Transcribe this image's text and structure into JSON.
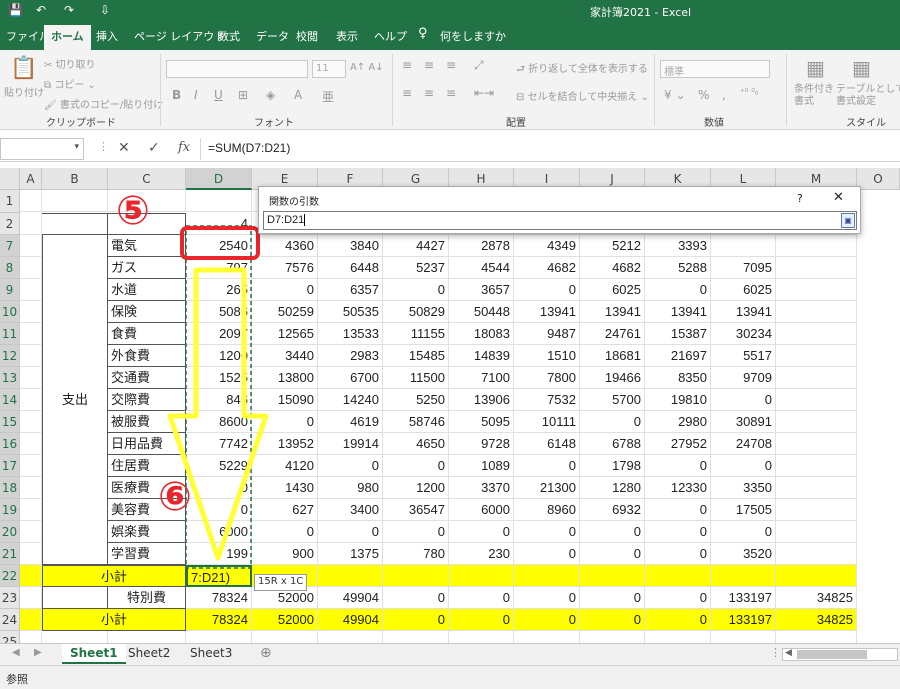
{
  "window": {
    "title": "家計簿2021 - Excel",
    "qat": [
      "💾",
      "↶",
      "↷",
      "⇩"
    ]
  },
  "ribbon_tabs": [
    "ファイル",
    "ホーム",
    "挿入",
    "ページ レイアウト",
    "数式",
    "データ",
    "校閲",
    "表示",
    "ヘルプ",
    "何をしますか"
  ],
  "tell_me_icon": "lightbulb-icon",
  "ribbon": {
    "clipboard": {
      "paste": "貼り付け",
      "cut": "切り取り",
      "copy": "コピー",
      "format_painter": "書式のコピー/貼り付け",
      "label": "クリップボード"
    },
    "font": {
      "size": "11",
      "label": "フォント",
      "buttons": [
        "B",
        "I",
        "U"
      ]
    },
    "alignment": {
      "wrap": "折り返して全体を表示する",
      "merge": "セルを結合して中央揃え",
      "label": "配置"
    },
    "number": {
      "format": "標準",
      "symbols": [
        "%",
        ","
      ],
      "label": "数値"
    },
    "styles": {
      "conditional": "条件付き\n書式",
      "table": "テーブルとして\n書式設定",
      "label": "スタイル"
    }
  },
  "formula_bar": {
    "formula": "=SUM(D7:D21)",
    "cancel": "✕",
    "enter": "✓",
    "fx": "fx"
  },
  "columns": [
    "A",
    "B",
    "C",
    "D",
    "E",
    "F",
    "G",
    "H",
    "I",
    "J",
    "K",
    "L",
    "M",
    "O"
  ],
  "rows": [
    "1",
    "2",
    "7",
    "8",
    "9",
    "10",
    "11",
    "12",
    "13",
    "14",
    "15",
    "16",
    "17",
    "18",
    "19",
    "20",
    "21",
    "22",
    "23",
    "24",
    "25"
  ],
  "category_label": "支出",
  "row2_d": "4",
  "expense_rows": [
    {
      "item": "電気",
      "values": [
        "2540",
        "4360",
        "3840",
        "4427",
        "2878",
        "4349",
        "5212",
        "3393",
        "",
        ""
      ]
    },
    {
      "item": "ガス",
      "values": [
        "797",
        "7576",
        "6448",
        "5237",
        "4544",
        "4682",
        "4682",
        "5288",
        "7095",
        ""
      ]
    },
    {
      "item": "水道",
      "values": [
        "265",
        "0",
        "6357",
        "0",
        "3657",
        "0",
        "6025",
        "0",
        "6025",
        ""
      ]
    },
    {
      "item": "保険",
      "values": [
        "5086",
        "50259",
        "50535",
        "50829",
        "50448",
        "13941",
        "13941",
        "13941",
        "13941",
        ""
      ]
    },
    {
      "item": "食費",
      "values": [
        "2097",
        "12565",
        "13533",
        "11155",
        "18083",
        "9487",
        "24761",
        "15387",
        "30234",
        ""
      ]
    },
    {
      "item": "外食費",
      "values": [
        "1200",
        "3440",
        "2983",
        "15485",
        "14839",
        "1510",
        "18681",
        "21697",
        "5517",
        ""
      ]
    },
    {
      "item": "交通費",
      "values": [
        "1525",
        "13800",
        "6700",
        "11500",
        "7100",
        "7800",
        "19466",
        "8350",
        "9709",
        ""
      ]
    },
    {
      "item": "交際費",
      "values": [
        "846",
        "15090",
        "14240",
        "5250",
        "13906",
        "7532",
        "5700",
        "19810",
        "0",
        ""
      ]
    },
    {
      "item": "被服費",
      "values": [
        "8600",
        "0",
        "4619",
        "58746",
        "5095",
        "10111",
        "0",
        "2980",
        "30891",
        ""
      ]
    },
    {
      "item": "日用品費",
      "values": [
        "7742",
        "13952",
        "19914",
        "4650",
        "9728",
        "6148",
        "6788",
        "27952",
        "24708",
        ""
      ]
    },
    {
      "item": "住居費",
      "values": [
        "5229",
        "4120",
        "0",
        "0",
        "1089",
        "0",
        "1798",
        "0",
        "0",
        ""
      ]
    },
    {
      "item": "医療費",
      "values": [
        "0",
        "1430",
        "980",
        "1200",
        "3370",
        "21300",
        "1280",
        "12330",
        "3350",
        ""
      ]
    },
    {
      "item": "美容費",
      "values": [
        "0",
        "627",
        "3400",
        "36547",
        "6000",
        "8960",
        "6932",
        "0",
        "17505",
        ""
      ]
    },
    {
      "item": "娯楽費",
      "values": [
        "6000",
        "0",
        "0",
        "0",
        "0",
        "0",
        "0",
        "0",
        "0",
        ""
      ]
    },
    {
      "item": "学習費",
      "values": [
        "199",
        "900",
        "1375",
        "780",
        "230",
        "0",
        "0",
        "0",
        "3520",
        ""
      ]
    }
  ],
  "subtotal_label": "小計",
  "subtotal_editing": "7:D21)",
  "range_tooltip": "15R x 1C",
  "special_row": {
    "item": "特別費",
    "values": [
      "78324",
      "52000",
      "49904",
      "0",
      "0",
      "0",
      "0",
      "0",
      "133197",
      "34825"
    ]
  },
  "subtotal2_row": {
    "label": "小計",
    "values": [
      "78324",
      "52000",
      "49904",
      "0",
      "0",
      "0",
      "0",
      "0",
      "133197",
      "34825"
    ]
  },
  "dialog": {
    "title": "関数の引数",
    "help": "?",
    "close": "✕",
    "value": "D7:D21"
  },
  "annotations": {
    "step5": "⑤",
    "step6": "⑥"
  },
  "sheets": [
    "Sheet1",
    "Sheet2",
    "Sheet3"
  ],
  "new_sheet": "⊕",
  "status": "参照",
  "colors": {
    "excel_green": "#217346",
    "highlight_yellow": "#ffff00",
    "annotation_red": "#e8262b",
    "arrow_yellow": "#ffff33"
  }
}
